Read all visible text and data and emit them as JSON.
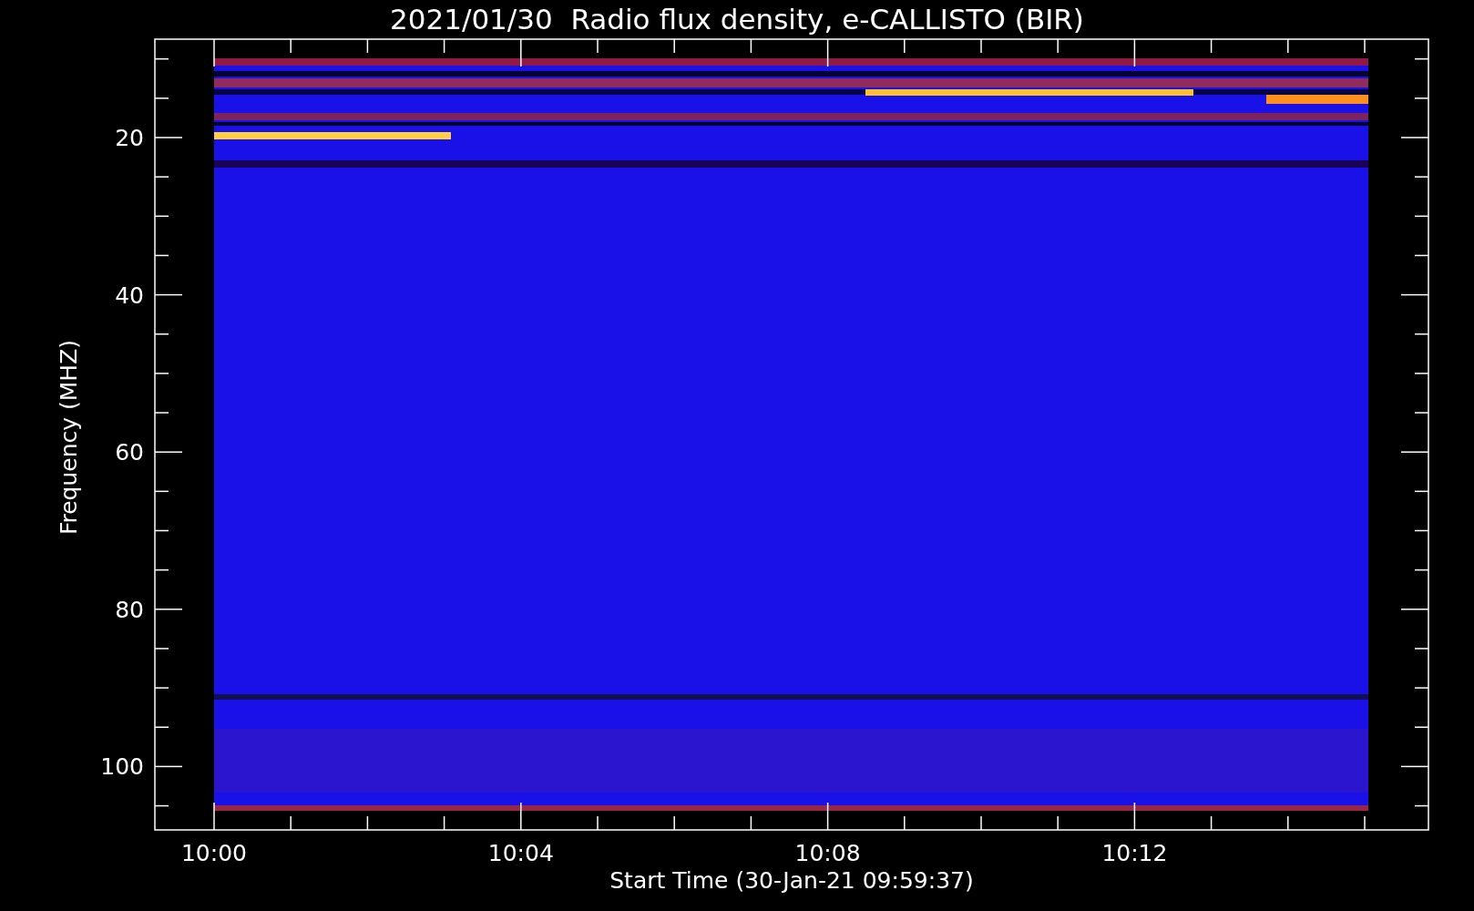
{
  "title": "2021/01/30  Radio flux density, e-CALLISTO (BIR)",
  "y_axis": {
    "label": "Frequency (MHZ)",
    "ticks": [
      "20",
      "40",
      "60",
      "80",
      "100"
    ]
  },
  "x_axis": {
    "label": "Start Time (30-Jan-21 09:59:37)",
    "ticks": [
      "10:00",
      "10:04",
      "10:08",
      "10:12"
    ]
  }
}
